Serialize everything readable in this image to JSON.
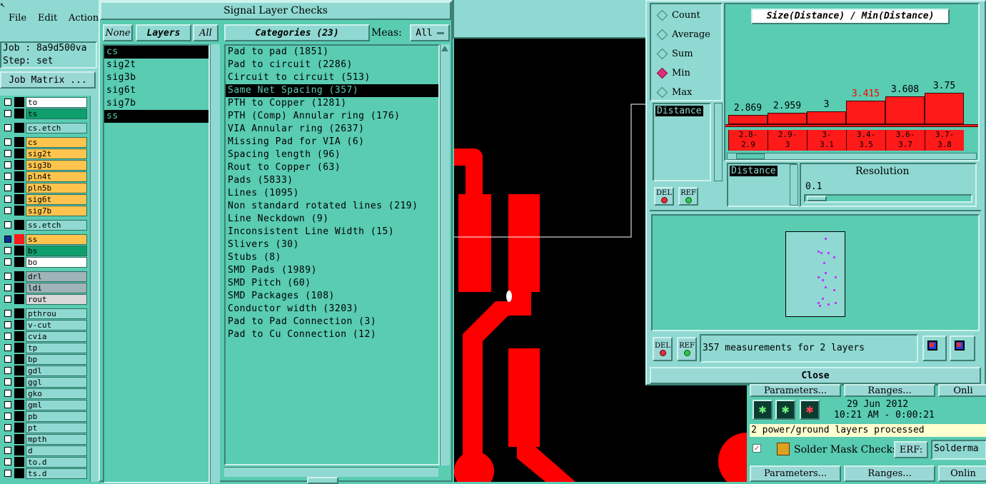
{
  "main_window": {
    "menu": [
      "File",
      "Edit",
      "Action"
    ],
    "job_line": "Job : 8a9d500va",
    "step_line": "Step: set",
    "job_matrix_button": "Job Matrix ...",
    "layers": [
      {
        "name": "to",
        "color": "#ffffff"
      },
      {
        "name": "ts",
        "color": "#0f9f6c"
      },
      {
        "name": "cs.etch",
        "color": "#8fd9d2"
      },
      {
        "name": "cs",
        "color": "#ffc44d"
      },
      {
        "name": "sig2t",
        "color": "#ffc44d"
      },
      {
        "name": "sig3b",
        "color": "#ffc44d"
      },
      {
        "name": "pln4t",
        "color": "#ffc44d"
      },
      {
        "name": "pln5b",
        "color": "#ffc44d"
      },
      {
        "name": "sig6t",
        "color": "#ffc44d"
      },
      {
        "name": "sig7b",
        "color": "#ffc44d"
      },
      {
        "name": "ss.etch",
        "color": "#8fd9d2"
      },
      {
        "name": "ss",
        "color": "#ffc44d"
      },
      {
        "name": "bs",
        "color": "#0f9f6c"
      },
      {
        "name": "bo",
        "color": "#ffffff"
      },
      {
        "name": "drl",
        "color": "#9fb4b8"
      },
      {
        "name": "ldi",
        "color": "#9fb4b8"
      },
      {
        "name": "rout",
        "color": "#d8d8d8"
      },
      {
        "name": "pthrou",
        "color": "#8fd9d2"
      },
      {
        "name": "v-cut",
        "color": "#8fd9d2"
      },
      {
        "name": "cvia",
        "color": "#8fd9d2"
      },
      {
        "name": "tp",
        "color": "#8fd9d2"
      },
      {
        "name": "bp",
        "color": "#8fd9d2"
      },
      {
        "name": "gdl",
        "color": "#8fd9d2"
      },
      {
        "name": "ggl",
        "color": "#8fd9d2"
      },
      {
        "name": "gko",
        "color": "#8fd9d2"
      },
      {
        "name": "gml",
        "color": "#8fd9d2"
      },
      {
        "name": "pb",
        "color": "#8fd9d2"
      },
      {
        "name": "pt",
        "color": "#8fd9d2"
      },
      {
        "name": "mpth",
        "color": "#8fd9d2"
      },
      {
        "name": "d",
        "color": "#8fd9d2"
      },
      {
        "name": "to.d",
        "color": "#8fd9d2"
      },
      {
        "name": "ts.d",
        "color": "#8fd9d2"
      }
    ]
  },
  "signal_dialog": {
    "title": "Signal Layer Checks",
    "none_btn": "None",
    "layers_label": "Layers",
    "all_btn": "All",
    "categories_label": "Categories (23)",
    "meas_label": "Meas:",
    "meas_value": "All",
    "layer_list": [
      "cs",
      "sig2t",
      "sig3b",
      "sig6t",
      "sig7b",
      "ss"
    ],
    "categories": [
      "Pad to pad (1851)",
      "Pad to circuit (2286)",
      "Circuit to circuit (513)",
      "Same Net Spacing (357)",
      "PTH to Copper (1281)",
      "PTH (Comp) Annular ring (176)",
      "VIA Annular ring (2637)",
      "Missing Pad for VIA (6)",
      "Spacing length (96)",
      "Rout to Copper (63)",
      "Pads (5833)",
      "Lines (1095)",
      "Non standard rotated lines (219)",
      "Line Neckdown (9)",
      "Inconsistent Line Width (15)",
      "Slivers (30)",
      "Stubs (8)",
      "SMD Pads (1989)",
      "SMD Pitch (60)",
      "SMD Packages (108)",
      "Conductor width (3203)",
      "Pad to Pad Connection (3)",
      "Pad to Cu Connection (12)"
    ]
  },
  "histogram": {
    "options": [
      "Count",
      "Average",
      "Sum",
      "Min",
      "Max"
    ],
    "selected_option": "Min",
    "title": "Size(Distance) / Min(Distance)",
    "bar_values": [
      "2.869",
      "2.959",
      "3",
      "3.415",
      "3.608",
      "3.75"
    ],
    "bar_heights": [
      2.869,
      2.959,
      3.0,
      3.415,
      3.608,
      3.75
    ],
    "highlight_index": 3,
    "ranges": [
      [
        "2.8-",
        "2.9"
      ],
      [
        "2.9-",
        "3"
      ],
      [
        "3-",
        "3.1"
      ],
      [
        "3.4-",
        "3.5"
      ],
      [
        "3.6-",
        "3.7"
      ],
      [
        "3.7-",
        "3.8"
      ]
    ],
    "attr_list": [
      "Distance"
    ],
    "del_label": "DEL",
    "ref_label": "REF",
    "x_field_label": "Distance",
    "resolution_label": "Resolution",
    "resolution_value": "0.1",
    "status": "357 measurements for 2 layers",
    "close_label": "Close"
  },
  "erf_panel": {
    "params_button": "Parameters...",
    "ranges_button": "Ranges...",
    "online_button": "Onli",
    "date": "29 Jun 2012",
    "time": "10:21 AM - 0:00:21",
    "message": "2 power/ground layers processed",
    "check_name": "Solder Mask Checks",
    "erf_label": "ERF:",
    "erf_value": "Solderma",
    "params_button2": "Parameters...",
    "ranges_button2": "Ranges...",
    "online_button2": "Onlin"
  },
  "colors": {
    "dialog_bg": "#59ccb2",
    "light_panel": "#8fd9d2",
    "copper": "#ff0000",
    "canvas": "#000000",
    "highlight_text": "#ff0000"
  }
}
